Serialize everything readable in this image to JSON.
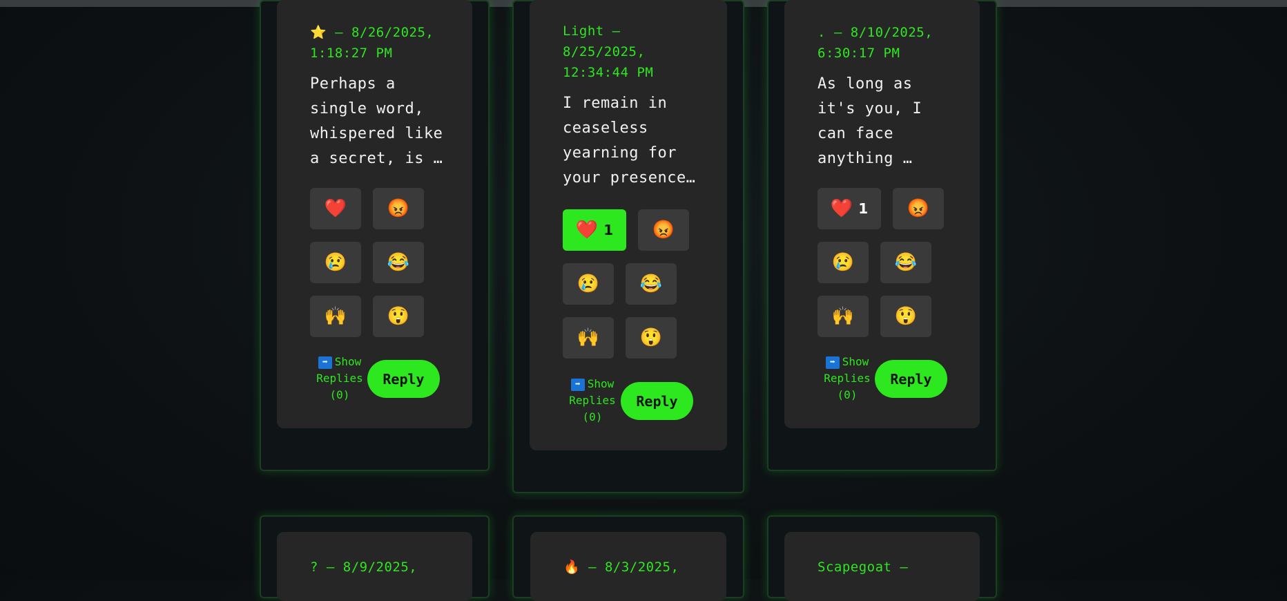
{
  "cards": [
    {
      "meta_line1": "⭐ — 8/26/2025,",
      "meta_line2": "1:18:27 PM",
      "msg_line1": "Perhaps a",
      "msg_line2": "single word,",
      "msg_line3": "whispered like",
      "msg_line4": "a secret, is …",
      "heart_count": "",
      "show_replies": "Show Replies (0)",
      "reply_label": "Reply"
    },
    {
      "meta_line1": "Light —",
      "meta_line2": "8/25/2025,",
      "meta_line3": "12:34:44 PM",
      "msg_line1": "I remain in",
      "msg_line2": "ceaseless",
      "msg_line3": "yearning for",
      "msg_line4": "your presence…",
      "heart_count": "1",
      "heart_active": true,
      "show_replies": "Show Replies (0)",
      "reply_label": "Reply"
    },
    {
      "meta_line1": ". — 8/10/2025,",
      "meta_line2": "6:30:17 PM",
      "msg_line1": "As long as",
      "msg_line2": "it's you, I",
      "msg_line3": "can face",
      "msg_line4": "anything …",
      "heart_count": "1",
      "show_replies": "Show Replies (0)",
      "reply_label": "Reply"
    },
    {
      "meta_line1": "? — 8/9/2025,"
    },
    {
      "meta_line1": "🔥 — 8/3/2025,"
    },
    {
      "meta_line1": "Scapegoat —"
    }
  ],
  "reactions": {
    "heart": "❤️",
    "angry": "😡",
    "sad": "😢",
    "joy": "😂",
    "raised_hands": "🙌",
    "astonished": "😲",
    "arrow": "➡"
  },
  "colors": {
    "accent": "#2ee81f",
    "card": "#262626",
    "button": "#3a3a3a",
    "page": "#0d1113"
  }
}
